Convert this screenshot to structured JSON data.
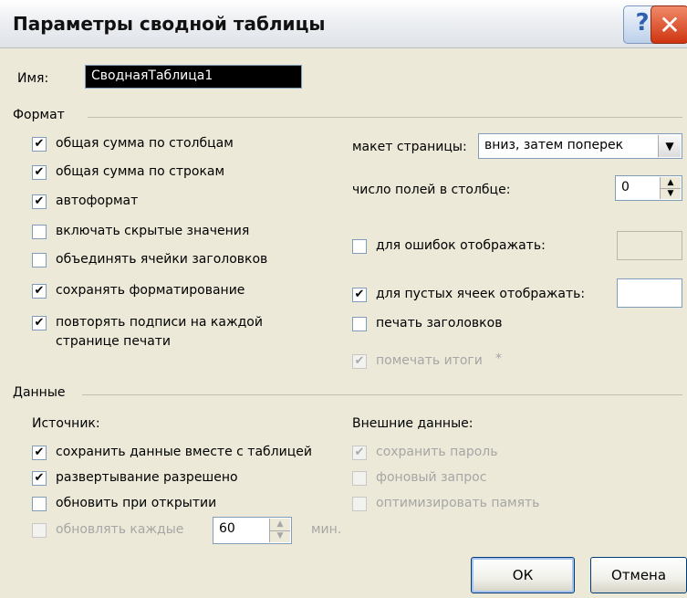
{
  "window": {
    "title": "Параметры сводной таблицы",
    "help_icon": "?",
    "close_icon": "✕"
  },
  "name": {
    "label": "Имя:",
    "value": "СводнаяТаблица1"
  },
  "format": {
    "group_label": "Формат",
    "checkboxes": [
      {
        "label": "общая сумма по столбцам",
        "checked": true
      },
      {
        "label": "общая сумма по строкам",
        "checked": true
      },
      {
        "label": "автоформат",
        "checked": true
      },
      {
        "label": "включать скрытые значения",
        "checked": false
      },
      {
        "label": "объединять ячейки заголовков",
        "checked": false
      },
      {
        "label": "сохранять форматирование",
        "checked": true
      },
      {
        "label": "повторять подписи на каждой",
        "label2": "странице печати",
        "checked": true
      }
    ],
    "page_layout_label": "макет страницы:",
    "page_layout_value": "вниз, затем поперек",
    "fields_per_column_label": "число полей в столбце:",
    "fields_per_column_value": "0",
    "errors_display": {
      "label": "для ошибок отображать:",
      "checked": false,
      "value": ""
    },
    "empty_cells_display": {
      "label": "для пустых ячеек отображать:",
      "checked": true,
      "value": ""
    },
    "print_titles": {
      "label": "печать заголовков",
      "checked": false
    },
    "mark_totals": {
      "label": "помечать итоги",
      "suffix": "*",
      "checked": true,
      "disabled": true
    }
  },
  "data": {
    "group_label": "Данные",
    "source_label": "Источник:",
    "source_checkboxes": [
      {
        "label": "сохранить данные вместе с таблицей",
        "checked": true
      },
      {
        "label": "развертывание разрешено",
        "checked": true
      },
      {
        "label": "обновить при открытии",
        "checked": false
      }
    ],
    "refresh_every": {
      "label": "обновлять каждые",
      "value": "60",
      "unit": "мин.",
      "checked": false,
      "disabled": true
    },
    "external_label": "Внешние данные:",
    "external_checkboxes": [
      {
        "label": "сохранить пароль",
        "checked": true,
        "disabled": true
      },
      {
        "label": "фоновый запрос",
        "checked": false,
        "disabled": true
      },
      {
        "label": "оптимизировать память",
        "checked": false,
        "disabled": true
      }
    ]
  },
  "buttons": {
    "ok": "ОК",
    "cancel": "Отмена"
  },
  "colors": {
    "dialog_bg": "#ece9d8",
    "close_red": "#cf3410",
    "disabled_text": "#a6a6a6"
  }
}
